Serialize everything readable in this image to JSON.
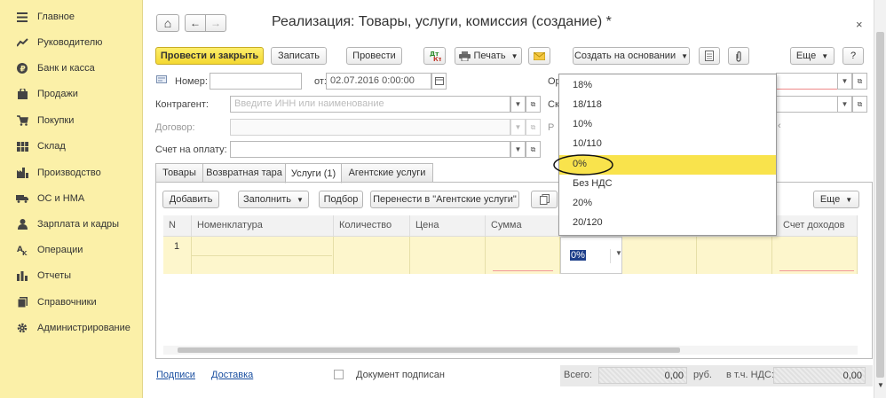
{
  "sidebar": {
    "items": [
      {
        "label": "Главное",
        "icon": "menu-icon"
      },
      {
        "label": "Руководителю",
        "icon": "chart-line-icon"
      },
      {
        "label": "Банк и касса",
        "icon": "coin-icon"
      },
      {
        "label": "Продажи",
        "icon": "bag-icon"
      },
      {
        "label": "Покупки",
        "icon": "cart-icon"
      },
      {
        "label": "Склад",
        "icon": "warehouse-icon"
      },
      {
        "label": "Производство",
        "icon": "factory-icon"
      },
      {
        "label": "ОС и НМА",
        "icon": "truck-icon"
      },
      {
        "label": "Зарплата и кадры",
        "icon": "person-icon"
      },
      {
        "label": "Операции",
        "icon": "operations-icon"
      },
      {
        "label": "Отчеты",
        "icon": "bar-chart-icon"
      },
      {
        "label": "Справочники",
        "icon": "book-icon"
      },
      {
        "label": "Администрирование",
        "icon": "gear-icon"
      }
    ]
  },
  "header": {
    "title": "Реализация: Товары, услуги, комиссия (создание) *",
    "home": "⌂",
    "back": "←",
    "forward": "→",
    "close": "×"
  },
  "toolbar": {
    "post_close": "Провести и закрыть",
    "save": "Записать",
    "post": "Провести",
    "print": "Печать",
    "create_based": "Создать на основании",
    "more": "Еще",
    "help": "?"
  },
  "form": {
    "number_label": "Номер:",
    "number_value": "",
    "date_label": "от:",
    "date_value": "02.07.2016  0:00:00",
    "org_label_partial": "Ор",
    "warehouse_label_partial": "Ск",
    "r_label_partial": "Р",
    "counterparty_label": "Контрагент:",
    "counterparty_placeholder": "Введите ИНН или наименование",
    "contract_label": "Договор:",
    "invoice_label": "Счет на оплату:"
  },
  "tabs": [
    {
      "label": "Товары"
    },
    {
      "label": "Возвратная тара"
    },
    {
      "label": "Услуги (1)"
    },
    {
      "label": "Агентские услуги"
    }
  ],
  "table_toolbar": {
    "add": "Добавить",
    "fill": "Заполнить",
    "pick": "Подбор",
    "move": "Перенести в \"Агентские услуги\"",
    "more": "Еще"
  },
  "table": {
    "columns": [
      "N",
      "Номенклатура",
      "Количество",
      "Цена",
      "Сумма",
      "Счет доходов"
    ],
    "rows": [
      {
        "n": "1",
        "vat_rate": "0%"
      }
    ]
  },
  "vat_dropdown": {
    "options": [
      "18%",
      "18/118",
      "10%",
      "10/110",
      "0%",
      "Без НДС",
      "20%",
      "20/120"
    ],
    "selected": "0%",
    "highlight_color": "#f9e34c"
  },
  "footer": {
    "signatures_link": "Подписи",
    "delivery_link": "Доставка",
    "signed_label": "Документ подписан",
    "total_label": "Всего:",
    "total_value": "0,00",
    "currency": "руб.",
    "vat_label": "в т.ч. НДС:",
    "vat_value": "0,00"
  },
  "colors": {
    "sidebar_bg": "#fbf0a8",
    "primary_button": "#f4d831",
    "row_bg": "#fdf6cc"
  }
}
